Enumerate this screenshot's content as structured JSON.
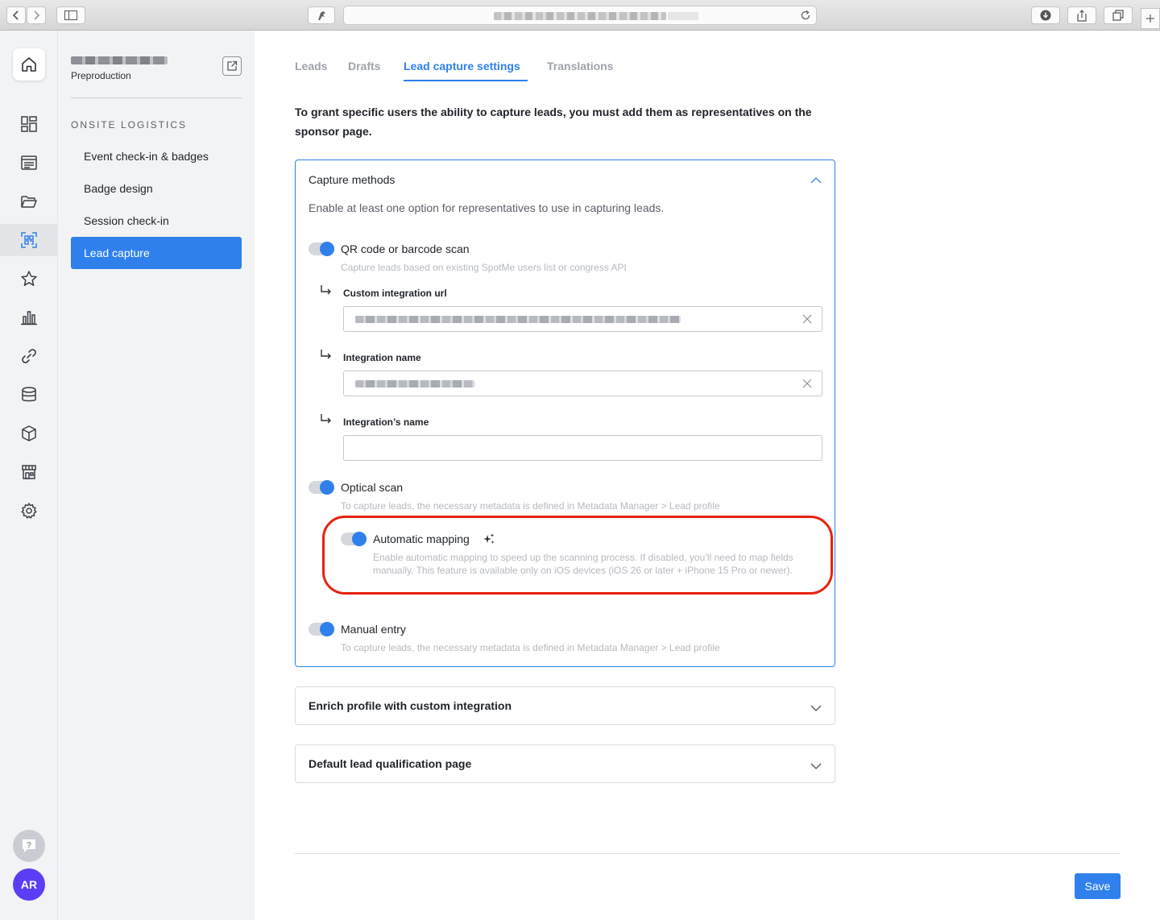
{
  "sidebar": {
    "environment": "Preproduction",
    "section_title": "ONSITE LOGISTICS",
    "items": [
      {
        "label": "Event check-in & badges"
      },
      {
        "label": "Badge design"
      },
      {
        "label": "Session check-in"
      },
      {
        "label": "Lead capture"
      }
    ],
    "active_item": "Lead capture"
  },
  "rail": {
    "icons": [
      "home-icon",
      "dashboard-icon",
      "list-icon",
      "folder-icon",
      "qr-scan-icon",
      "star-icon",
      "bar-chart-icon",
      "link-icon",
      "database-icon",
      "cube-icon",
      "store-icon",
      "gear-icon"
    ],
    "active_icon": "qr-scan-icon",
    "avatar_initials": "AR",
    "help_symbol": "?"
  },
  "tabs": [
    {
      "label": "Leads"
    },
    {
      "label": "Drafts"
    },
    {
      "label": "Lead capture settings"
    },
    {
      "label": "Translations"
    }
  ],
  "active_tab": "Lead capture settings",
  "intro_text": "To grant specific users the ability to capture leads, you must add them as representatives on the sponsor page.",
  "capture_methods": {
    "title": "Capture methods",
    "subtitle": "Enable at least one option for representatives to use in capturing leads.",
    "qr": {
      "label": "QR code or barcode scan",
      "enabled": true,
      "description": "Capture leads based on existing SpotMe users list or congress API",
      "fields": [
        {
          "label": "Custom integration url"
        },
        {
          "label": "Integration name"
        },
        {
          "label": "Integration’s name",
          "value": ""
        }
      ]
    },
    "optical": {
      "label": "Optical scan",
      "enabled": true,
      "description": "To capture leads, the necessary metadata is defined in Metadata Manager > Lead profile",
      "automatic_mapping": {
        "label": "Automatic mapping",
        "enabled": true,
        "description": "Enable automatic mapping to speed up the scanning process. If disabled, you’ll need to map fields manually. This feature is available only on iOS devices (iOS 26 or later + iPhone 15 Pro or newer)."
      }
    },
    "manual": {
      "label": "Manual entry",
      "enabled": true,
      "description": "To capture leads, the necessary metadata is defined in Metadata Manager > Lead profile"
    }
  },
  "panels": [
    {
      "title": "Enrich profile with custom integration"
    },
    {
      "title": "Default lead qualification page"
    }
  ],
  "save_label": "Save",
  "colors": {
    "accent": "#2f80ed",
    "highlight": "#e8210f",
    "avatar": "#5b3df5"
  }
}
